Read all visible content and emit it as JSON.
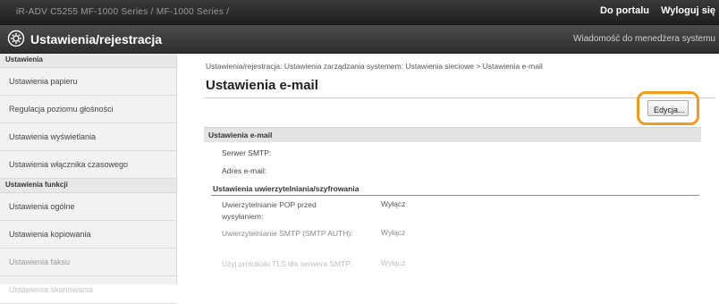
{
  "header": {
    "device_name": "iR-ADV C5255  MF-1000 Series / MF-1000 Series /",
    "links": [
      "Do portalu",
      "Wyloguj się"
    ]
  },
  "titlebar": {
    "title": "Ustawienia/rejestracja",
    "message": "Wiadomość do menedżera systemu",
    "icon": "gear-icon"
  },
  "sidebar": {
    "section1": "Ustawienia",
    "items1": [
      "Ustawienia papieru",
      "Regulacja poziomu głośności",
      "Ustawienia wyświetlania",
      "Ustawienia włącznika czasowego"
    ],
    "section2": "Ustawienia funkcji",
    "items2": [
      "Ustawienia ogólne",
      "Ustawienia kopiowania",
      "Ustawienia faksu",
      "Ustawienia skanowania"
    ]
  },
  "main": {
    "breadcrumb": "Ustawienia/rejestracja: Ustawienia zarządzania systemem: Ustawienia sieciowe > Ustawienia e-mail",
    "title": "Ustawienia e-mail",
    "edit_label": "Edycja...",
    "section_title": "Ustawienia e-mail",
    "smtp_server_label": "Serwer SMTP:",
    "email_label": "Adres e-mail:",
    "auth_head": "Ustawienia uwierzytelniania/szyfrowania",
    "auth_rows": [
      {
        "label": "Uwierzytelnianie POP przed wysyłaniem:",
        "value": "Wyłącz"
      },
      {
        "label": "Uwierzytelnianie SMTP (SMTP AUTH):",
        "value": "Wyłącz"
      },
      {
        "label": "Użyj protokołu TLS dla serwera SMTP:",
        "value": "Wyłącz"
      }
    ]
  },
  "colors": {
    "highlight": "#f39b1a",
    "topbar": "#2a2a2a"
  }
}
